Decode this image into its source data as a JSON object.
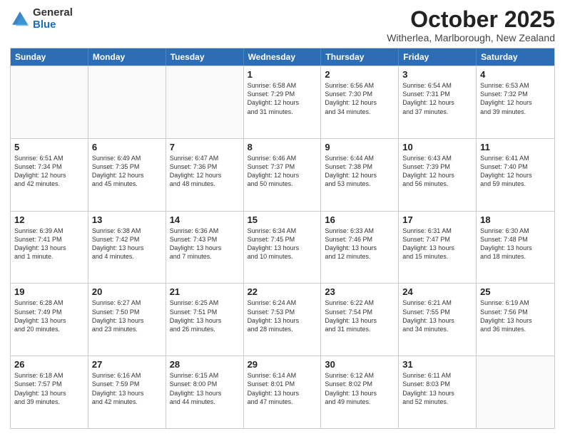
{
  "header": {
    "logo_general": "General",
    "logo_blue": "Blue",
    "month_title": "October 2025",
    "subtitle": "Witherlea, Marlborough, New Zealand"
  },
  "weekdays": [
    "Sunday",
    "Monday",
    "Tuesday",
    "Wednesday",
    "Thursday",
    "Friday",
    "Saturday"
  ],
  "rows": [
    [
      {
        "day": "",
        "info": ""
      },
      {
        "day": "",
        "info": ""
      },
      {
        "day": "",
        "info": ""
      },
      {
        "day": "1",
        "info": "Sunrise: 6:58 AM\nSunset: 7:29 PM\nDaylight: 12 hours\nand 31 minutes."
      },
      {
        "day": "2",
        "info": "Sunrise: 6:56 AM\nSunset: 7:30 PM\nDaylight: 12 hours\nand 34 minutes."
      },
      {
        "day": "3",
        "info": "Sunrise: 6:54 AM\nSunset: 7:31 PM\nDaylight: 12 hours\nand 37 minutes."
      },
      {
        "day": "4",
        "info": "Sunrise: 6:53 AM\nSunset: 7:32 PM\nDaylight: 12 hours\nand 39 minutes."
      }
    ],
    [
      {
        "day": "5",
        "info": "Sunrise: 6:51 AM\nSunset: 7:34 PM\nDaylight: 12 hours\nand 42 minutes."
      },
      {
        "day": "6",
        "info": "Sunrise: 6:49 AM\nSunset: 7:35 PM\nDaylight: 12 hours\nand 45 minutes."
      },
      {
        "day": "7",
        "info": "Sunrise: 6:47 AM\nSunset: 7:36 PM\nDaylight: 12 hours\nand 48 minutes."
      },
      {
        "day": "8",
        "info": "Sunrise: 6:46 AM\nSunset: 7:37 PM\nDaylight: 12 hours\nand 50 minutes."
      },
      {
        "day": "9",
        "info": "Sunrise: 6:44 AM\nSunset: 7:38 PM\nDaylight: 12 hours\nand 53 minutes."
      },
      {
        "day": "10",
        "info": "Sunrise: 6:43 AM\nSunset: 7:39 PM\nDaylight: 12 hours\nand 56 minutes."
      },
      {
        "day": "11",
        "info": "Sunrise: 6:41 AM\nSunset: 7:40 PM\nDaylight: 12 hours\nand 59 minutes."
      }
    ],
    [
      {
        "day": "12",
        "info": "Sunrise: 6:39 AM\nSunset: 7:41 PM\nDaylight: 13 hours\nand 1 minute."
      },
      {
        "day": "13",
        "info": "Sunrise: 6:38 AM\nSunset: 7:42 PM\nDaylight: 13 hours\nand 4 minutes."
      },
      {
        "day": "14",
        "info": "Sunrise: 6:36 AM\nSunset: 7:43 PM\nDaylight: 13 hours\nand 7 minutes."
      },
      {
        "day": "15",
        "info": "Sunrise: 6:34 AM\nSunset: 7:45 PM\nDaylight: 13 hours\nand 10 minutes."
      },
      {
        "day": "16",
        "info": "Sunrise: 6:33 AM\nSunset: 7:46 PM\nDaylight: 13 hours\nand 12 minutes."
      },
      {
        "day": "17",
        "info": "Sunrise: 6:31 AM\nSunset: 7:47 PM\nDaylight: 13 hours\nand 15 minutes."
      },
      {
        "day": "18",
        "info": "Sunrise: 6:30 AM\nSunset: 7:48 PM\nDaylight: 13 hours\nand 18 minutes."
      }
    ],
    [
      {
        "day": "19",
        "info": "Sunrise: 6:28 AM\nSunset: 7:49 PM\nDaylight: 13 hours\nand 20 minutes."
      },
      {
        "day": "20",
        "info": "Sunrise: 6:27 AM\nSunset: 7:50 PM\nDaylight: 13 hours\nand 23 minutes."
      },
      {
        "day": "21",
        "info": "Sunrise: 6:25 AM\nSunset: 7:51 PM\nDaylight: 13 hours\nand 26 minutes."
      },
      {
        "day": "22",
        "info": "Sunrise: 6:24 AM\nSunset: 7:53 PM\nDaylight: 13 hours\nand 28 minutes."
      },
      {
        "day": "23",
        "info": "Sunrise: 6:22 AM\nSunset: 7:54 PM\nDaylight: 13 hours\nand 31 minutes."
      },
      {
        "day": "24",
        "info": "Sunrise: 6:21 AM\nSunset: 7:55 PM\nDaylight: 13 hours\nand 34 minutes."
      },
      {
        "day": "25",
        "info": "Sunrise: 6:19 AM\nSunset: 7:56 PM\nDaylight: 13 hours\nand 36 minutes."
      }
    ],
    [
      {
        "day": "26",
        "info": "Sunrise: 6:18 AM\nSunset: 7:57 PM\nDaylight: 13 hours\nand 39 minutes."
      },
      {
        "day": "27",
        "info": "Sunrise: 6:16 AM\nSunset: 7:59 PM\nDaylight: 13 hours\nand 42 minutes."
      },
      {
        "day": "28",
        "info": "Sunrise: 6:15 AM\nSunset: 8:00 PM\nDaylight: 13 hours\nand 44 minutes."
      },
      {
        "day": "29",
        "info": "Sunrise: 6:14 AM\nSunset: 8:01 PM\nDaylight: 13 hours\nand 47 minutes."
      },
      {
        "day": "30",
        "info": "Sunrise: 6:12 AM\nSunset: 8:02 PM\nDaylight: 13 hours\nand 49 minutes."
      },
      {
        "day": "31",
        "info": "Sunrise: 6:11 AM\nSunset: 8:03 PM\nDaylight: 13 hours\nand 52 minutes."
      },
      {
        "day": "",
        "info": ""
      }
    ]
  ]
}
